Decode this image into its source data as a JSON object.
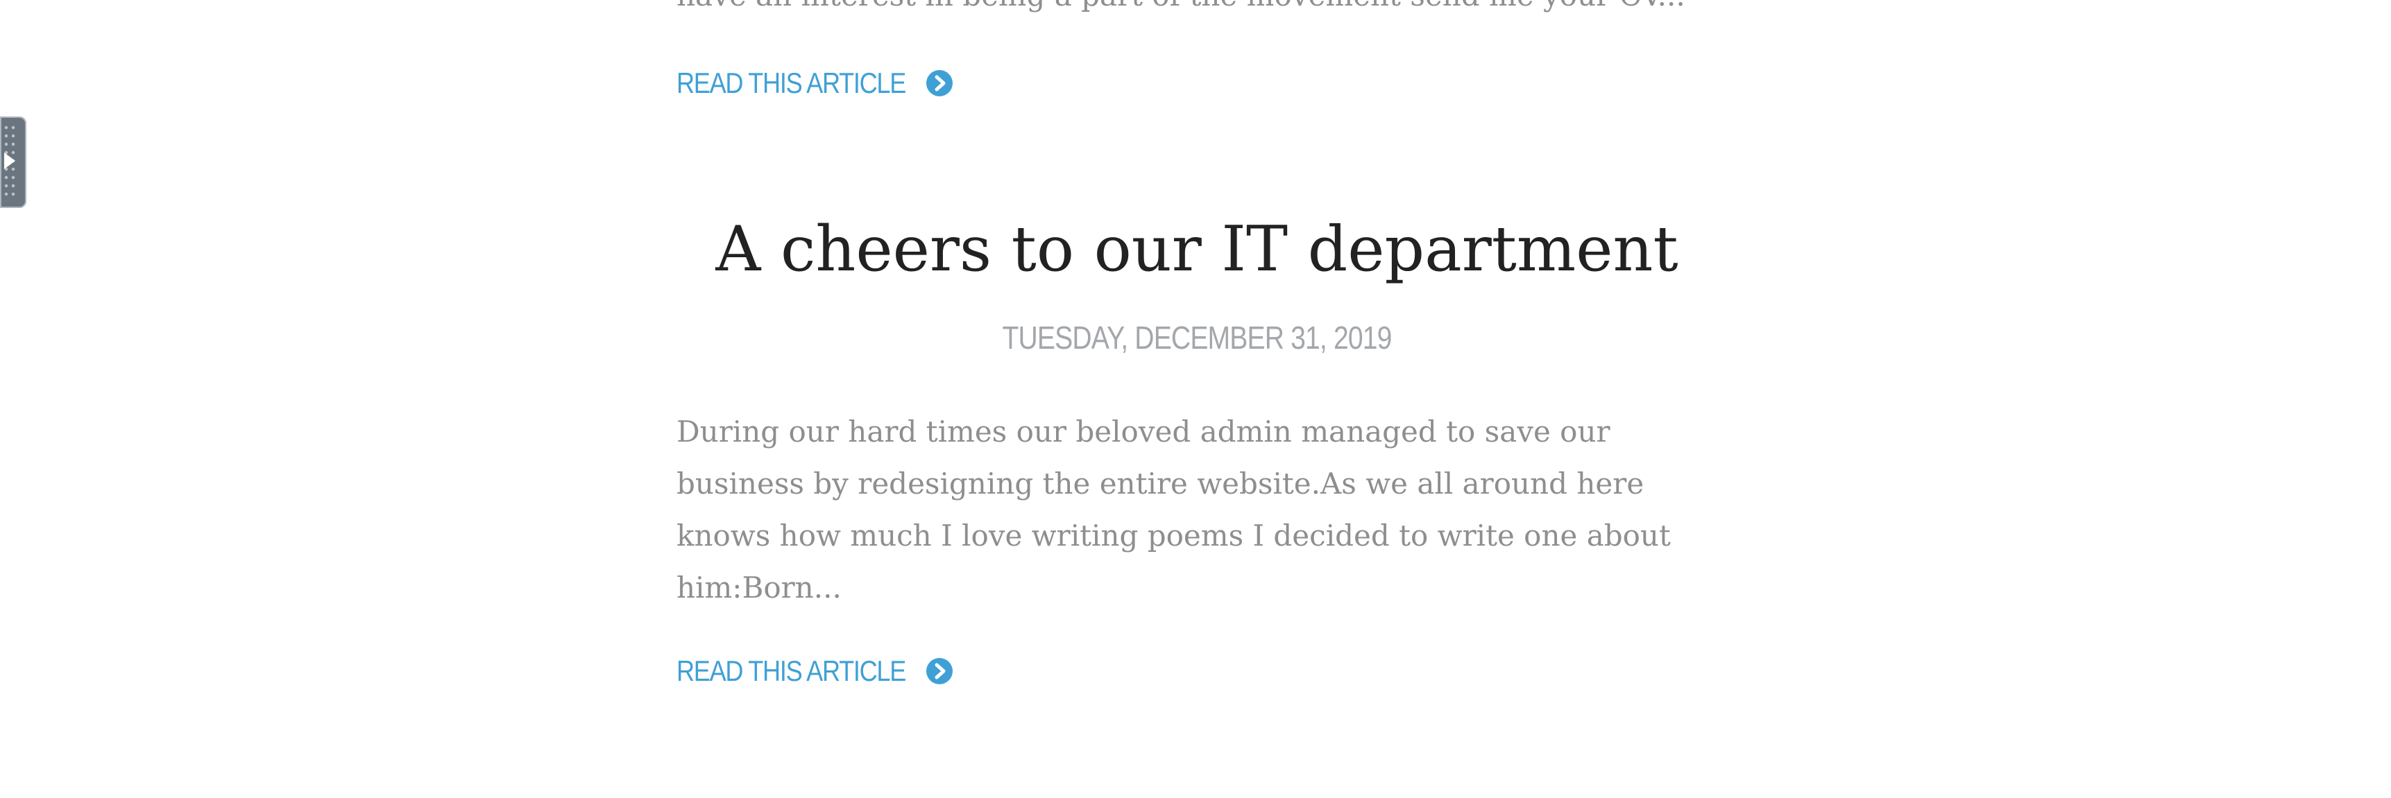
{
  "previous_article": {
    "excerpt_tail": "have an interest in being a part of the movement send me your CV...",
    "read_more_label": "READ THIS ARTICLE"
  },
  "article": {
    "title": "A cheers to our IT department",
    "date": "TUESDAY, DECEMBER 31, 2019",
    "excerpt": "During our hard times our beloved admin managed to save our business by redesigning the entire website.As we all around here knows how much I love writing poems I decided to write one about him:Born...",
    "read_more_label": "READ THIS ARTICLE"
  },
  "colors": {
    "link": "#3fa0d6",
    "title": "#222222",
    "body": "#8e8e8e",
    "date": "#a3a7ab",
    "side_tab": "#6a7580"
  },
  "icons": {
    "read_more": "chevron-circle-right-icon",
    "side_tab": "play-arrow-icon"
  }
}
